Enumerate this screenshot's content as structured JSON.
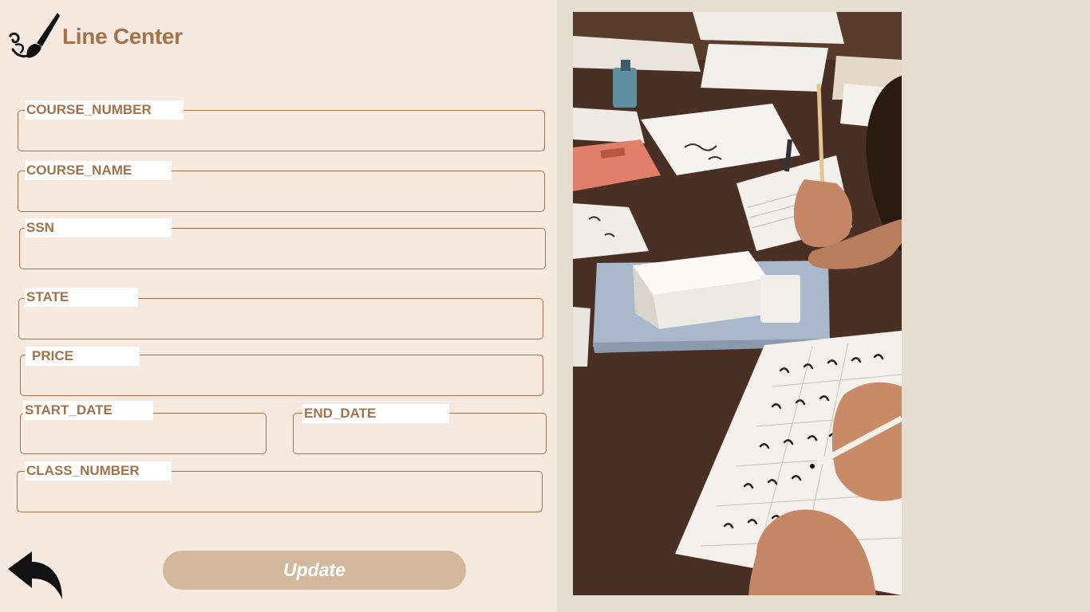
{
  "brand": {
    "name": "Line Center",
    "icon": "paintbrush-icon",
    "color": "#a4724a"
  },
  "form": {
    "course_number": {
      "label": "COURSE_NUMBER",
      "value": ""
    },
    "course_name": {
      "label": "COURSE_NAME",
      "value": ""
    },
    "ssn": {
      "label": "SSN",
      "value": ""
    },
    "state": {
      "label": "STATE",
      "value": ""
    },
    "price": {
      "label": "PRICE",
      "value": ""
    },
    "start_date": {
      "label": "START_DATE",
      "value": ""
    },
    "end_date": {
      "label": "END_DATE",
      "value": ""
    },
    "class_number": {
      "label": "CLASS_NUMBER",
      "value": ""
    }
  },
  "actions": {
    "update_label": "Update",
    "back_icon": "back-arrow-icon"
  },
  "colors": {
    "panel_bg": "#f5e9e0",
    "right_bg": "#e6ddd1",
    "accent": "#a87048",
    "button_bg": "#d4b89c"
  },
  "photo": {
    "subject": "calligraphy-class-photo"
  }
}
